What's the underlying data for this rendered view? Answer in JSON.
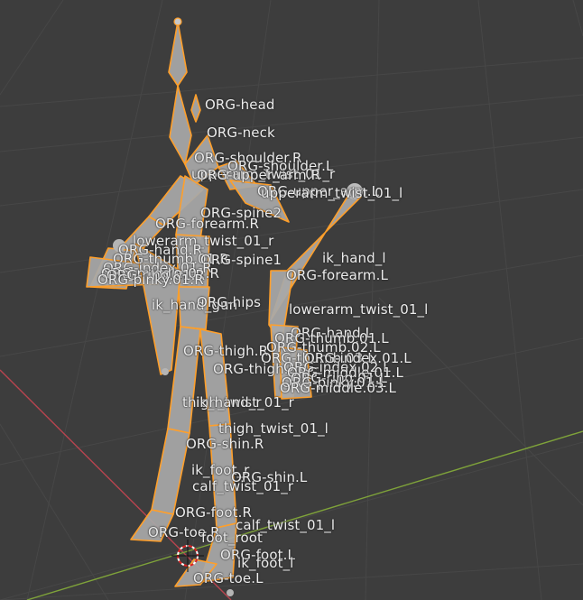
{
  "viewport": {
    "background": "#3d3d3d",
    "grid_color": "#474747",
    "x_axis_color": "#b8444f",
    "y_axis_color": "#7fa33a",
    "bone_fill": "#a8a8a8",
    "bone_outline": "#ff9f2a"
  },
  "bone_labels": {
    "head": "ORG-head",
    "neck": "ORG-neck",
    "shoulder_r": "ORG-shoulder.R",
    "shoulder_l": "ORG-shoulder.L",
    "upperarm_twist_r": "upperarm_twist_01_r",
    "upperarm_r": "ORG-upper_arm.R",
    "upper_arm_l": "ORG-upper_arm.L",
    "upperarm_twist_l": "upperarm_twist_01_l",
    "spine2": "ORG-spine2",
    "forearm_r": "ORG-forearm.R",
    "lowerarm_twist_r": "lowerarm_twist_01_r",
    "hand_r": "ORG-hand.R",
    "thumb_r": "ORG-thumb.01.R",
    "spine1": "ORG-spine1",
    "ik_hand_l": "ik_hand_l",
    "forearm_l": "ORG-forearm.L",
    "index_r": "ORG-index.01.R",
    "middle_r": "ORG-middle.01.R",
    "ring_r": "ORG-ring.01.R",
    "pinky_r": "ORG-pinky.01.R",
    "ik_hand_gun": "ik_hand_gun",
    "hips": "ORG-hips",
    "lowerarm_twist_l": "lowerarm_twist_01_l",
    "hand_l": "ORG-hand.L",
    "thumb01_l": "ORG-thumb.01.L",
    "thigh_r": "ORG-thigh.R",
    "thumb02_l": "ORG-thumb.02.L",
    "thumb03_l": "ORG-thumb.03.L",
    "index01_l": "ORG-index.01.L",
    "thigh_l": "ORG-thigh.L",
    "index02_l": "ORG-index.02.L",
    "middle01_l": "ORG-middle.01.L",
    "ring01_l": "ORG-ring.01.L",
    "pinky01_l": "ORG-pinky.01.L",
    "middle03_l": "ORG-middle.03.L",
    "thigh_twist_r": "thigh_twist_01_r",
    "ik_hand_r": "ik_hand_r",
    "thigh_twist_l": "thigh_twist_01_l",
    "shin_r": "ORG-shin.R",
    "ik_foot_r": "ik_foot_r",
    "shin_l": "ORG-shin.L",
    "calf_twist_r": "calf_twist_01_r",
    "foot_r": "ORG-foot.R",
    "calf_twist_l": "calf_twist_01_l",
    "toe_r": "ORG-toe.R",
    "foot_root": "foot_root",
    "foot_l": "ORG-foot.L",
    "ik_foot_l": "ik_foot_l",
    "toe_l": "ORG-toe.L"
  }
}
